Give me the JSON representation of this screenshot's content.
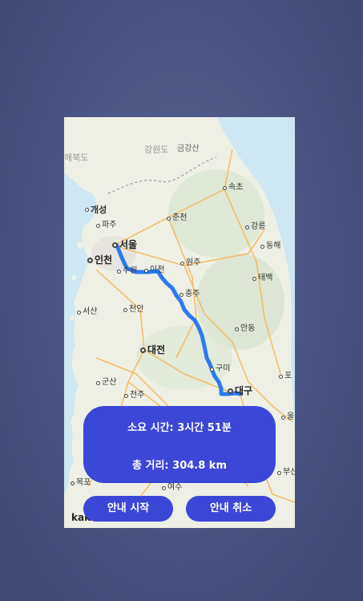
{
  "map": {
    "cities": [
      {
        "name": "개성",
        "major": false
      },
      {
        "name": "파주",
        "major": false
      },
      {
        "name": "춘천",
        "major": false
      },
      {
        "name": "속초",
        "major": false
      },
      {
        "name": "강릉",
        "major": false
      },
      {
        "name": "동해",
        "major": false
      },
      {
        "name": "서울",
        "major": true
      },
      {
        "name": "인천",
        "major": true
      },
      {
        "name": "수원",
        "major": false
      },
      {
        "name": "이천",
        "major": false
      },
      {
        "name": "원주",
        "major": false
      },
      {
        "name": "태백",
        "major": false
      },
      {
        "name": "충주",
        "major": false
      },
      {
        "name": "서산",
        "major": false
      },
      {
        "name": "천안",
        "major": false
      },
      {
        "name": "안동",
        "major": false
      },
      {
        "name": "대전",
        "major": true
      },
      {
        "name": "구미",
        "major": false
      },
      {
        "name": "포",
        "major": false
      },
      {
        "name": "군산",
        "major": false
      },
      {
        "name": "전주",
        "major": false
      },
      {
        "name": "대구",
        "major": true
      },
      {
        "name": "울",
        "major": false
      },
      {
        "name": "목포",
        "major": false
      },
      {
        "name": "여수",
        "major": false
      },
      {
        "name": "부산",
        "major": false
      }
    ],
    "regions": [
      "강원도",
      "금강산",
      "해북도"
    ],
    "logo_text": "kak",
    "colors": {
      "route": "#2b7bf0",
      "sea": "#cfe7f2",
      "land": "#eef0e6",
      "road": "#f5b85a"
    }
  },
  "info": {
    "duration": "소요 시간: 3시간 51분",
    "distance": "총 거리: 304.8 km"
  },
  "buttons": {
    "start": "안내 시작",
    "cancel": "안내 취소"
  }
}
